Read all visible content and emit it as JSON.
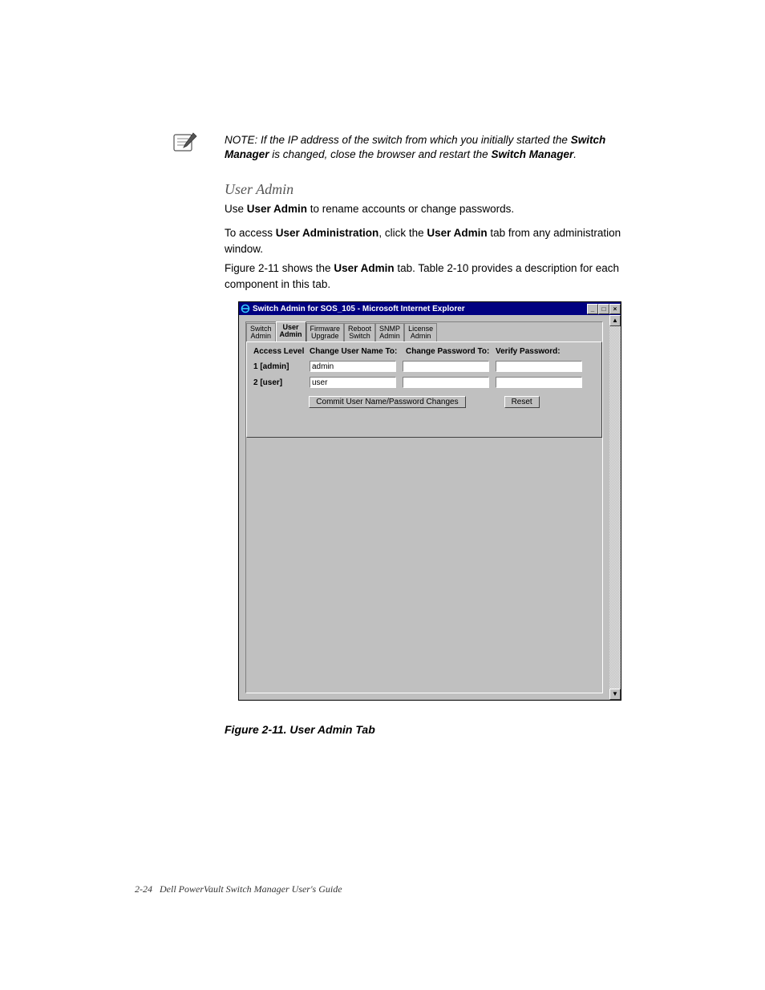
{
  "note": {
    "prefix": "NOTE: If the IP address of the switch from which you initially started the ",
    "bold1": "Switch Manager",
    "mid": " is changed, close the browser and restart the ",
    "bold2": "Switch Manager",
    "suffix": "."
  },
  "heading": "User Admin",
  "paragraphs": {
    "p1_a": "Use ",
    "p1_b": "User Admin",
    "p1_c": " to rename accounts or change passwords.",
    "p2_a": "To access ",
    "p2_b": "User Administration",
    "p2_c": ", click the ",
    "p2_d": "User Admin",
    "p2_e": " tab from any administration window.",
    "p3_a": "Figure 2-11 shows the ",
    "p3_b": "User Admin",
    "p3_c": " tab. Table 2-10 provides a description for each component in this tab."
  },
  "screenshot": {
    "title": "Switch Admin for SOS_105 - Microsoft Internet Explorer",
    "window_controls": {
      "min": "_",
      "max": "□",
      "close": "×"
    },
    "scroll": {
      "up": "▲",
      "down": "▼"
    },
    "tabs": [
      "Switch\nAdmin",
      "User\nAdmin",
      "Firmware\nUpgrade",
      "Reboot\nSwitch",
      "SNMP\nAdmin",
      "License\nAdmin"
    ],
    "active_tab_index": 1,
    "columns": {
      "access": "Access Level",
      "name": "Change User Name To:",
      "pw": "Change Password To:",
      "vp": "Verify Password:"
    },
    "rows": [
      {
        "label": "1 [admin]",
        "username": "admin",
        "pw": "",
        "vp": ""
      },
      {
        "label": "2 [user]",
        "username": "user",
        "pw": "",
        "vp": ""
      }
    ],
    "buttons": {
      "commit": "Commit User Name/Password Changes",
      "reset": "Reset"
    }
  },
  "figure_caption": "Figure 2-11.  User Admin Tab",
  "footer": {
    "page": "2-24",
    "title": "Dell PowerVault Switch Manager User's Guide"
  }
}
